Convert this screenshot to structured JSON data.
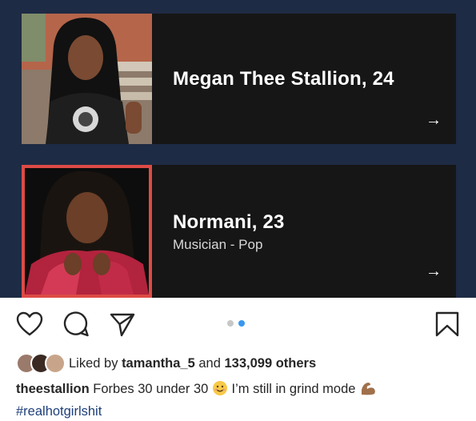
{
  "cards": [
    {
      "name": "Megan Thee Stallion, 24",
      "subtitle": "",
      "arrow": "→"
    },
    {
      "name": "Normani, 23",
      "subtitle": "Musician - Pop",
      "arrow": "→"
    }
  ],
  "colors": {
    "post_background": "#1e2b44",
    "card_background": "#161616",
    "highlight_border": "#dd4b45",
    "dot_active": "#3897f0",
    "dot_inactive": "#c7c7c7",
    "hashtag": "#1e3f7a"
  },
  "icons": {
    "like": "heart-icon",
    "comment": "comment-icon",
    "share": "share-icon",
    "save": "bookmark-icon",
    "caption_emoji_1": "smiling-face-icon",
    "caption_emoji_2": "flexed-biceps-icon"
  },
  "carousel": {
    "total": 2,
    "current": 2
  },
  "likes": {
    "prefix": "Liked by",
    "user": "tamantha_5",
    "middle": "and",
    "count": "133,099 others"
  },
  "caption": {
    "username": "theestallion",
    "text": "Forbes 30 under 30",
    "text2": "I’m still in grind mode",
    "hashtag": "#realhotgirlshit"
  }
}
